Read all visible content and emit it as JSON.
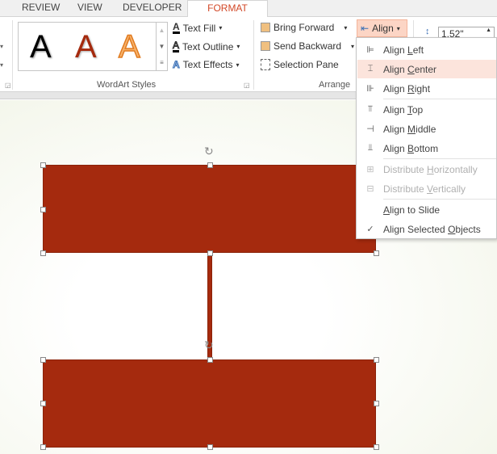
{
  "tabs": [
    {
      "label": "REVIEW"
    },
    {
      "label": "VIEW"
    },
    {
      "label": "DEVELOPER"
    },
    {
      "label": "FORMAT",
      "active": true
    }
  ],
  "wordart": {
    "group_label": "WordArt Styles",
    "styles": [
      "A",
      "A",
      "A"
    ],
    "text_fill": "Text Fill",
    "text_outline": "Text Outline",
    "text_effects": "Text Effects"
  },
  "arrange": {
    "group_label": "Arrange",
    "bring_forward": "Bring Forward",
    "send_backward": "Send Backward",
    "selection_pane": "Selection Pane",
    "align": "Align"
  },
  "size": {
    "height_value": "1.52\""
  },
  "align_menu": [
    {
      "pre": "Align ",
      "key": "L",
      "post": "eft",
      "icon": "align-left-icon"
    },
    {
      "pre": "Align ",
      "key": "C",
      "post": "enter",
      "icon": "align-center-icon",
      "highlighted": true
    },
    {
      "pre": "Align ",
      "key": "R",
      "post": "ight",
      "icon": "align-right-icon"
    },
    {
      "pre": "Align ",
      "key": "T",
      "post": "op",
      "icon": "align-top-icon"
    },
    {
      "pre": "Align ",
      "key": "M",
      "post": "iddle",
      "icon": "align-middle-icon"
    },
    {
      "pre": "Align ",
      "key": "B",
      "post": "ottom",
      "icon": "align-bottom-icon"
    },
    {
      "pre": "Distribute ",
      "key": "H",
      "post": "orizontally",
      "icon": "distribute-horizontally-icon",
      "disabled": true
    },
    {
      "pre": "Distribute ",
      "key": "V",
      "post": "ertically",
      "icon": "distribute-vertically-icon",
      "disabled": true
    },
    {
      "pre": "",
      "key": "A",
      "post": "lign to Slide",
      "icon": ""
    },
    {
      "pre": "Align Selected ",
      "key": "O",
      "post": "bjects",
      "icon": "check-icon",
      "checked": true
    }
  ],
  "colors": {
    "accent": "#d24726",
    "shape_fill": "#a52a0e",
    "highlight": "#fce4dc"
  }
}
